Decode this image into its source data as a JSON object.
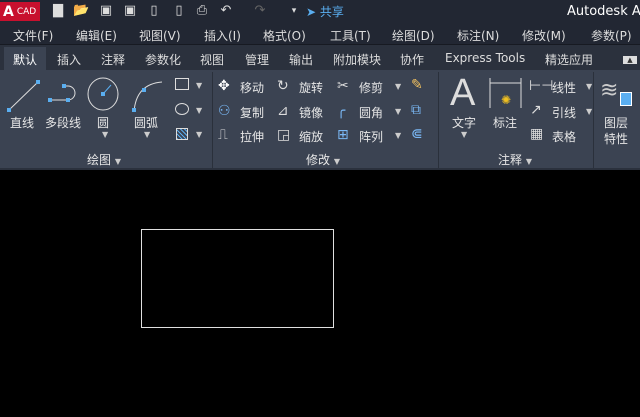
{
  "title_bar": {
    "logo_text": "A",
    "logo_sub": "CAD",
    "share": "共享",
    "app_title": "Autodesk Au"
  },
  "menu": [
    "文件(F)",
    "编辑(E)",
    "视图(V)",
    "插入(I)",
    "格式(O)",
    "工具(T)",
    "绘图(D)",
    "标注(N)",
    "修改(M)",
    "参数(P)"
  ],
  "tabs": [
    "默认",
    "插入",
    "注释",
    "参数化",
    "视图",
    "管理",
    "输出",
    "附加模块",
    "协作",
    "Express Tools",
    "精选应用"
  ],
  "draw_panel": {
    "title": "绘图",
    "line": "直线",
    "polyline": "多段线",
    "circle": "圆",
    "arc": "圆弧"
  },
  "modify_panel": {
    "title": "修改",
    "move": "移动",
    "rotate": "旋转",
    "trim": "修剪",
    "copy": "复制",
    "mirror": "镜像",
    "fillet": "圆角",
    "stretch": "拉伸",
    "scale": "缩放",
    "array": "阵列"
  },
  "annotation_panel": {
    "title": "注释",
    "text": "文字",
    "dimension": "标注",
    "linear": "线性",
    "leader": "引线",
    "table": "表格"
  },
  "layers_panel": {
    "layer_properties_1": "图层",
    "layer_properties_2": "特性"
  }
}
